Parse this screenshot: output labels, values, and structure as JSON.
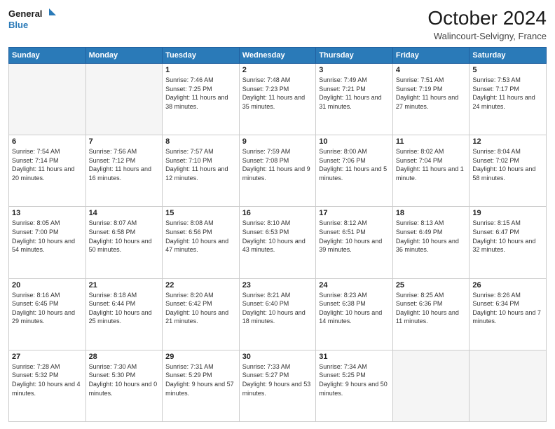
{
  "logo": {
    "line1": "General",
    "line2": "Blue"
  },
  "header": {
    "month": "October 2024",
    "location": "Walincourt-Selvigny, France"
  },
  "weekdays": [
    "Sunday",
    "Monday",
    "Tuesday",
    "Wednesday",
    "Thursday",
    "Friday",
    "Saturday"
  ],
  "weeks": [
    [
      {
        "day": "",
        "empty": true
      },
      {
        "day": "",
        "empty": true
      },
      {
        "day": "1",
        "sunrise": "Sunrise: 7:46 AM",
        "sunset": "Sunset: 7:25 PM",
        "daylight": "Daylight: 11 hours and 38 minutes."
      },
      {
        "day": "2",
        "sunrise": "Sunrise: 7:48 AM",
        "sunset": "Sunset: 7:23 PM",
        "daylight": "Daylight: 11 hours and 35 minutes."
      },
      {
        "day": "3",
        "sunrise": "Sunrise: 7:49 AM",
        "sunset": "Sunset: 7:21 PM",
        "daylight": "Daylight: 11 hours and 31 minutes."
      },
      {
        "day": "4",
        "sunrise": "Sunrise: 7:51 AM",
        "sunset": "Sunset: 7:19 PM",
        "daylight": "Daylight: 11 hours and 27 minutes."
      },
      {
        "day": "5",
        "sunrise": "Sunrise: 7:53 AM",
        "sunset": "Sunset: 7:17 PM",
        "daylight": "Daylight: 11 hours and 24 minutes."
      }
    ],
    [
      {
        "day": "6",
        "sunrise": "Sunrise: 7:54 AM",
        "sunset": "Sunset: 7:14 PM",
        "daylight": "Daylight: 11 hours and 20 minutes."
      },
      {
        "day": "7",
        "sunrise": "Sunrise: 7:56 AM",
        "sunset": "Sunset: 7:12 PM",
        "daylight": "Daylight: 11 hours and 16 minutes."
      },
      {
        "day": "8",
        "sunrise": "Sunrise: 7:57 AM",
        "sunset": "Sunset: 7:10 PM",
        "daylight": "Daylight: 11 hours and 12 minutes."
      },
      {
        "day": "9",
        "sunrise": "Sunrise: 7:59 AM",
        "sunset": "Sunset: 7:08 PM",
        "daylight": "Daylight: 11 hours and 9 minutes."
      },
      {
        "day": "10",
        "sunrise": "Sunrise: 8:00 AM",
        "sunset": "Sunset: 7:06 PM",
        "daylight": "Daylight: 11 hours and 5 minutes."
      },
      {
        "day": "11",
        "sunrise": "Sunrise: 8:02 AM",
        "sunset": "Sunset: 7:04 PM",
        "daylight": "Daylight: 11 hours and 1 minute."
      },
      {
        "day": "12",
        "sunrise": "Sunrise: 8:04 AM",
        "sunset": "Sunset: 7:02 PM",
        "daylight": "Daylight: 10 hours and 58 minutes."
      }
    ],
    [
      {
        "day": "13",
        "sunrise": "Sunrise: 8:05 AM",
        "sunset": "Sunset: 7:00 PM",
        "daylight": "Daylight: 10 hours and 54 minutes."
      },
      {
        "day": "14",
        "sunrise": "Sunrise: 8:07 AM",
        "sunset": "Sunset: 6:58 PM",
        "daylight": "Daylight: 10 hours and 50 minutes."
      },
      {
        "day": "15",
        "sunrise": "Sunrise: 8:08 AM",
        "sunset": "Sunset: 6:56 PM",
        "daylight": "Daylight: 10 hours and 47 minutes."
      },
      {
        "day": "16",
        "sunrise": "Sunrise: 8:10 AM",
        "sunset": "Sunset: 6:53 PM",
        "daylight": "Daylight: 10 hours and 43 minutes."
      },
      {
        "day": "17",
        "sunrise": "Sunrise: 8:12 AM",
        "sunset": "Sunset: 6:51 PM",
        "daylight": "Daylight: 10 hours and 39 minutes."
      },
      {
        "day": "18",
        "sunrise": "Sunrise: 8:13 AM",
        "sunset": "Sunset: 6:49 PM",
        "daylight": "Daylight: 10 hours and 36 minutes."
      },
      {
        "day": "19",
        "sunrise": "Sunrise: 8:15 AM",
        "sunset": "Sunset: 6:47 PM",
        "daylight": "Daylight: 10 hours and 32 minutes."
      }
    ],
    [
      {
        "day": "20",
        "sunrise": "Sunrise: 8:16 AM",
        "sunset": "Sunset: 6:45 PM",
        "daylight": "Daylight: 10 hours and 29 minutes."
      },
      {
        "day": "21",
        "sunrise": "Sunrise: 8:18 AM",
        "sunset": "Sunset: 6:44 PM",
        "daylight": "Daylight: 10 hours and 25 minutes."
      },
      {
        "day": "22",
        "sunrise": "Sunrise: 8:20 AM",
        "sunset": "Sunset: 6:42 PM",
        "daylight": "Daylight: 10 hours and 21 minutes."
      },
      {
        "day": "23",
        "sunrise": "Sunrise: 8:21 AM",
        "sunset": "Sunset: 6:40 PM",
        "daylight": "Daylight: 10 hours and 18 minutes."
      },
      {
        "day": "24",
        "sunrise": "Sunrise: 8:23 AM",
        "sunset": "Sunset: 6:38 PM",
        "daylight": "Daylight: 10 hours and 14 minutes."
      },
      {
        "day": "25",
        "sunrise": "Sunrise: 8:25 AM",
        "sunset": "Sunset: 6:36 PM",
        "daylight": "Daylight: 10 hours and 11 minutes."
      },
      {
        "day": "26",
        "sunrise": "Sunrise: 8:26 AM",
        "sunset": "Sunset: 6:34 PM",
        "daylight": "Daylight: 10 hours and 7 minutes."
      }
    ],
    [
      {
        "day": "27",
        "sunrise": "Sunrise: 7:28 AM",
        "sunset": "Sunset: 5:32 PM",
        "daylight": "Daylight: 10 hours and 4 minutes."
      },
      {
        "day": "28",
        "sunrise": "Sunrise: 7:30 AM",
        "sunset": "Sunset: 5:30 PM",
        "daylight": "Daylight: 10 hours and 0 minutes."
      },
      {
        "day": "29",
        "sunrise": "Sunrise: 7:31 AM",
        "sunset": "Sunset: 5:29 PM",
        "daylight": "Daylight: 9 hours and 57 minutes."
      },
      {
        "day": "30",
        "sunrise": "Sunrise: 7:33 AM",
        "sunset": "Sunset: 5:27 PM",
        "daylight": "Daylight: 9 hours and 53 minutes."
      },
      {
        "day": "31",
        "sunrise": "Sunrise: 7:34 AM",
        "sunset": "Sunset: 5:25 PM",
        "daylight": "Daylight: 9 hours and 50 minutes."
      },
      {
        "day": "",
        "empty": true
      },
      {
        "day": "",
        "empty": true
      }
    ]
  ]
}
